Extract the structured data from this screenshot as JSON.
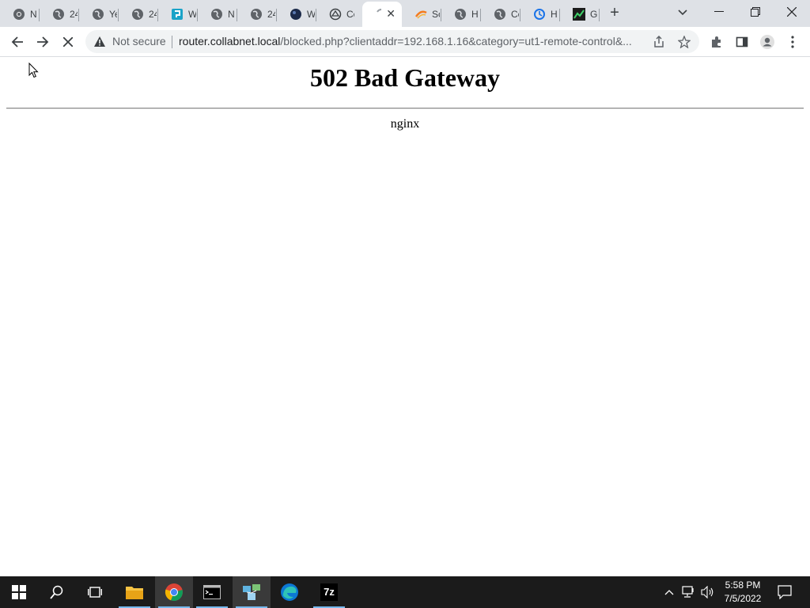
{
  "tabs": [
    {
      "title": "N",
      "icon": "chrome-icon"
    },
    {
      "title": "24",
      "icon": "globe-icon"
    },
    {
      "title": "Ye",
      "icon": "globe-icon"
    },
    {
      "title": "24",
      "icon": "globe-icon"
    },
    {
      "title": "W",
      "icon": "app-icon"
    },
    {
      "title": "N",
      "icon": "globe-icon"
    },
    {
      "title": "24",
      "icon": "globe-icon"
    },
    {
      "title": "W",
      "icon": "planet-icon"
    },
    {
      "title": "Cc",
      "icon": "site-icon"
    },
    {
      "title": "",
      "icon": "loading-spinner-icon",
      "active": true
    },
    {
      "title": "Sc",
      "icon": "swirl-icon"
    },
    {
      "title": "H",
      "icon": "globe-icon"
    },
    {
      "title": "Cc",
      "icon": "globe-icon"
    },
    {
      "title": "H",
      "icon": "history-icon"
    },
    {
      "title": "G",
      "icon": "chart-icon"
    }
  ],
  "address_bar": {
    "security_label": "Not secure",
    "url_host": "router.collabnet.local",
    "url_path": "/blocked.php?clientaddr=192.168.1.16&category=ut1-remote-control&..."
  },
  "page": {
    "heading": "502 Bad Gateway",
    "server": "nginx"
  },
  "taskbar": {
    "apps": [
      "start-icon",
      "search-icon",
      "task-view-icon",
      "file-explorer-icon",
      "chrome-icon",
      "terminal-icon",
      "network-app-icon",
      "edge-icon",
      "7zip-icon"
    ],
    "app_7z_label": "7z",
    "clock_time": "5:58 PM",
    "clock_date": "7/5/2022"
  },
  "colors": {
    "tabstrip_bg": "#dee1e6",
    "omnibox_bg": "#f1f3f4",
    "taskbar_bg": "#1b1b1b",
    "taskbar_accent": "#76b9ed"
  }
}
